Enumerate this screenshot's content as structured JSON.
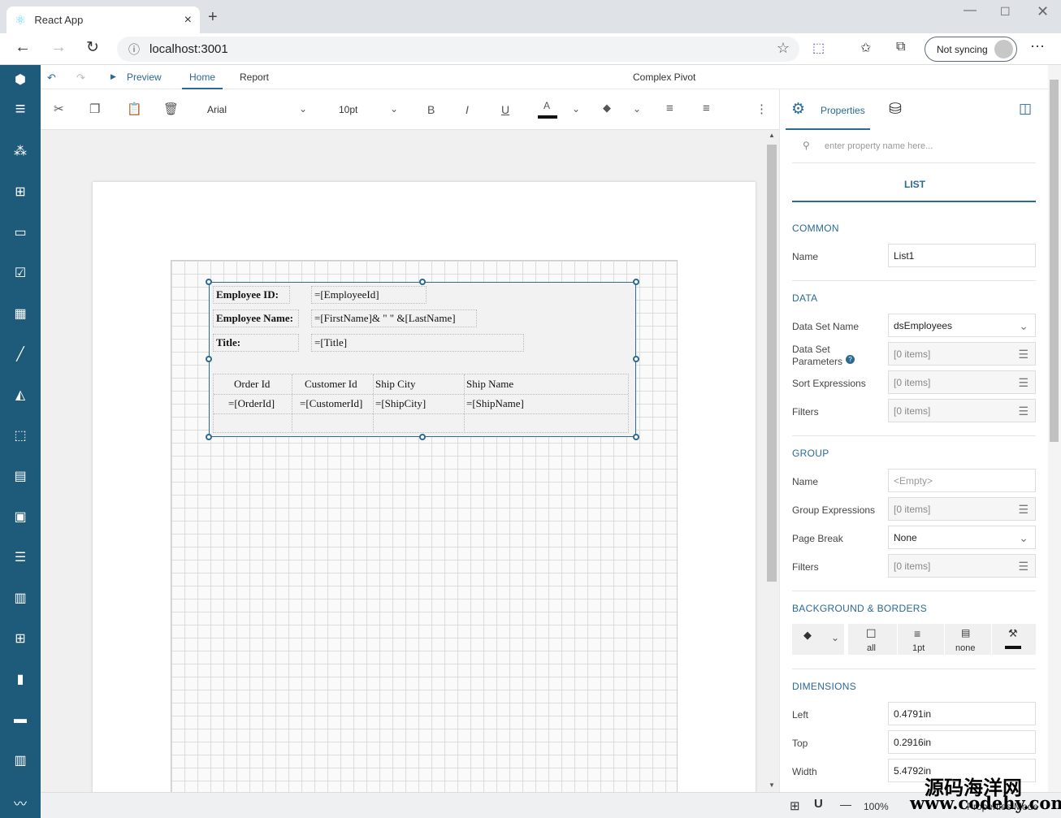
{
  "browser": {
    "tab_title": "React App",
    "url": "localhost:3001",
    "sync_label": "Not syncing",
    "close_tab": "×",
    "new_tab": "+",
    "more": "⋯"
  },
  "menubar": {
    "preview": "Preview",
    "home": "Home",
    "report": "Report",
    "doc_title": "Complex Pivot"
  },
  "toolbar": {
    "font": "Arial",
    "size": "10pt",
    "bold": "B",
    "italic": "I",
    "underline": "U",
    "color_letter": "A"
  },
  "panel": {
    "tab_properties": "Properties",
    "search_placeholder": "enter property name here...",
    "list_title": "LIST",
    "common": {
      "header": "COMMON",
      "name_label": "Name",
      "name_value": "List1"
    },
    "data": {
      "header": "DATA",
      "ds_label": "Data Set Name",
      "ds_value": "dsEmployees",
      "params_label1": "Data Set",
      "params_label2": "Parameters",
      "params_value": "[0 items]",
      "sort_label": "Sort Expressions",
      "sort_value": "[0 items]",
      "filters_label": "Filters",
      "filters_value": "[0 items]"
    },
    "group": {
      "header": "GROUP",
      "name_label": "Name",
      "name_value": "<Empty>",
      "gexpr_label": "Group Expressions",
      "gexpr_value": "[0 items]",
      "pb_label": "Page Break",
      "pb_value": "None",
      "filters_label": "Filters",
      "filters_value": "[0 items]"
    },
    "bb": {
      "header": "BACKGROUND & BORDERS",
      "all": "all",
      "width": "1pt",
      "style": "none"
    },
    "dims": {
      "header": "DIMENSIONS",
      "left_label": "Left",
      "left_value": "0.4791in",
      "top_label": "Top",
      "top_value": "0.2916in",
      "width_label": "Width",
      "width_value": "5.4792in"
    }
  },
  "report": {
    "emp_id_label": "Employee ID:",
    "emp_id_expr": "=[EmployeeId]",
    "emp_name_label": "Employee Name:",
    "emp_name_expr": "=[FirstName]& \" \" &[LastName]",
    "title_label": "Title:",
    "title_expr": "=[Title]",
    "table_headers": [
      "Order Id",
      "Customer Id",
      "Ship City",
      "Ship Name"
    ],
    "table_exprs": [
      "=[OrderId]",
      "=[CustomerId]",
      "=[ShipCity]",
      "=[ShipName]"
    ]
  },
  "status": {
    "zoom": "100%",
    "mode": "Properties Mode"
  },
  "watermark": {
    "line1": "源码海洋网",
    "line2": "www.codehy.com"
  }
}
